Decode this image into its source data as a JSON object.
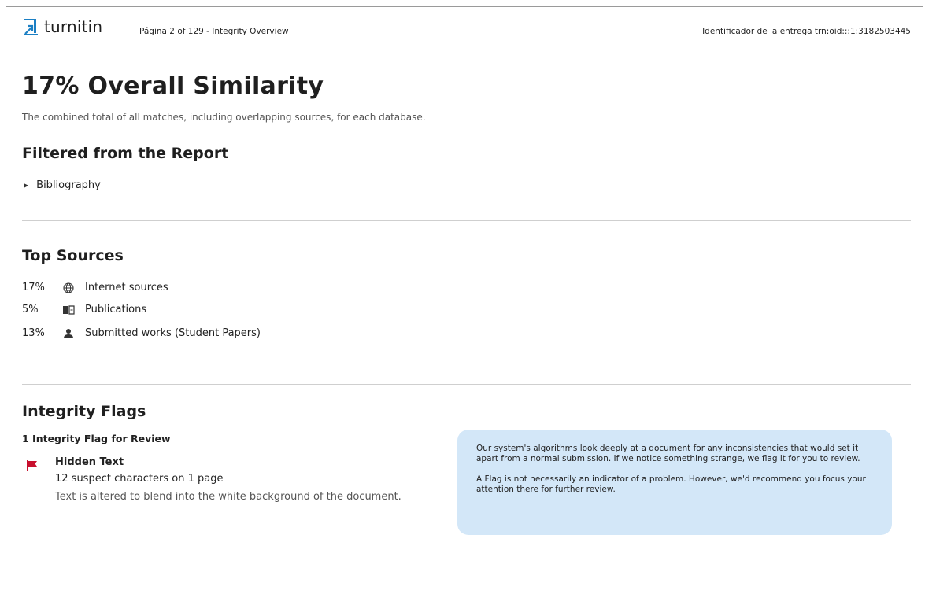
{
  "header": {
    "logo_text": "turnitin",
    "page_info": "Página 2 of 129 - Integrity Overview",
    "submission_id": "Identificador de la entrega trn:oid:::1:3182503445"
  },
  "overview": {
    "title": "17% Overall Similarity",
    "subtitle": "The combined total of all matches, including overlapping sources, for each database."
  },
  "filtered": {
    "title": "Filtered from the Report",
    "items": [
      {
        "label": "Bibliography"
      }
    ]
  },
  "top_sources": {
    "title": "Top Sources",
    "rows": [
      {
        "percent": "17%",
        "icon": "globe-icon",
        "label": "Internet sources"
      },
      {
        "percent": "5%",
        "icon": "book-icon",
        "label": "Publications"
      },
      {
        "percent": "13%",
        "icon": "person-icon",
        "label": "Submitted works (Student Papers)"
      }
    ]
  },
  "integrity": {
    "title": "Integrity Flags",
    "count_label": "1 Integrity Flag for Review",
    "flag": {
      "icon": "flag-icon",
      "name": "Hidden Text",
      "detail": "12 suspect characters on 1 page",
      "description": "Text is altered to blend into the white background of the document."
    },
    "info_paragraphs": [
      "Our system's algorithms look deeply at a document for any inconsistencies that would set it apart from a normal submission. If we notice something strange, we flag it for you to review.",
      "A Flag is not necessarily an indicator of a problem. However, we'd recommend you focus your attention there for further review."
    ]
  },
  "colors": {
    "brand_blue": "#1b7fc4",
    "flag_red": "#c8102e",
    "info_box_bg": "#d3e7f8"
  }
}
